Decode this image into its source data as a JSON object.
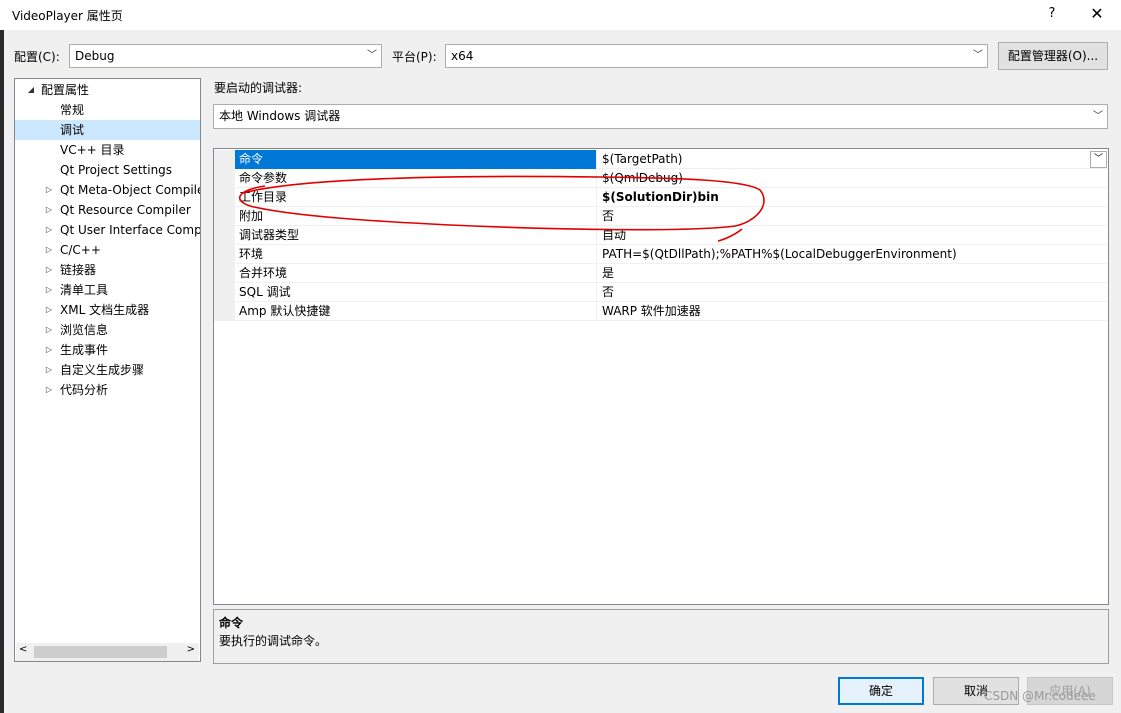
{
  "window": {
    "title": "VideoPlayer 属性页",
    "help": "?",
    "close": "✕"
  },
  "toolbar": {
    "config_label": "配置(C):",
    "config_value": "Debug",
    "platform_label": "平台(P):",
    "platform_value": "x64",
    "config_manager": "配置管理器(O)..."
  },
  "tree": {
    "root": "配置属性",
    "items": [
      {
        "label": "常规",
        "expandable": false,
        "selected": false
      },
      {
        "label": "调试",
        "expandable": false,
        "selected": true
      },
      {
        "label": "VC++ 目录",
        "expandable": false,
        "selected": false
      },
      {
        "label": "Qt Project Settings",
        "expandable": false,
        "selected": false
      },
      {
        "label": "Qt Meta-Object Compiler",
        "expandable": true,
        "selected": false
      },
      {
        "label": "Qt Resource Compiler",
        "expandable": true,
        "selected": false
      },
      {
        "label": "Qt User Interface Compiler",
        "expandable": true,
        "selected": false
      },
      {
        "label": "C/C++",
        "expandable": true,
        "selected": false
      },
      {
        "label": "链接器",
        "expandable": true,
        "selected": false
      },
      {
        "label": "清单工具",
        "expandable": true,
        "selected": false
      },
      {
        "label": "XML 文档生成器",
        "expandable": true,
        "selected": false
      },
      {
        "label": "浏览信息",
        "expandable": true,
        "selected": false
      },
      {
        "label": "生成事件",
        "expandable": true,
        "selected": false
      },
      {
        "label": "自定义生成步骤",
        "expandable": true,
        "selected": false
      },
      {
        "label": "代码分析",
        "expandable": true,
        "selected": false
      }
    ]
  },
  "debugger": {
    "label": "要启动的调试器:",
    "value": "本地 Windows 调试器"
  },
  "properties": [
    {
      "name": "命令",
      "value": "$(TargetPath)",
      "selected": true,
      "bold": false
    },
    {
      "name": "命令参数",
      "value": "$(QmlDebug)",
      "selected": false,
      "bold": false
    },
    {
      "name": "工作目录",
      "value": "$(SolutionDir)bin",
      "selected": false,
      "bold": true
    },
    {
      "name": "附加",
      "value": "否",
      "selected": false,
      "bold": false
    },
    {
      "name": "调试器类型",
      "value": "自动",
      "selected": false,
      "bold": false
    },
    {
      "name": "环境",
      "value": "PATH=$(QtDllPath);%PATH%$(LocalDebuggerEnvironment)",
      "selected": false,
      "bold": false
    },
    {
      "name": "合并环境",
      "value": "是",
      "selected": false,
      "bold": false
    },
    {
      "name": "SQL 调试",
      "value": "否",
      "selected": false,
      "bold": false
    },
    {
      "name": "Amp 默认快捷键",
      "value": "WARP 软件加速器",
      "selected": false,
      "bold": false
    }
  ],
  "description": {
    "title": "命令",
    "text": "要执行的调试命令。"
  },
  "buttons": {
    "ok": "确定",
    "cancel": "取消",
    "apply": "应用(A)"
  },
  "watermark": "CSDN @Mr.codeee",
  "colors": {
    "selection": "#0078d7",
    "tree_selection": "#cce8ff",
    "annotation": "#e00000"
  }
}
